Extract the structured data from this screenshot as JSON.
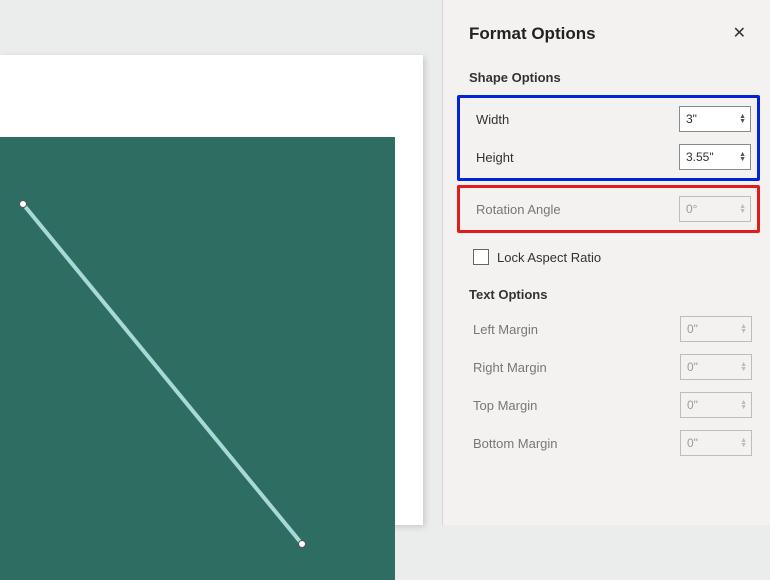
{
  "panel": {
    "title": "Format Options",
    "sections": {
      "shape_title": "Shape Options",
      "text_title": "Text Options"
    },
    "width": {
      "label": "Width",
      "value": "3\""
    },
    "height": {
      "label": "Height",
      "value": "3.55\""
    },
    "rotation": {
      "label": "Rotation Angle",
      "value": "0°"
    },
    "lock_aspect": {
      "label": "Lock Aspect Ratio"
    },
    "left_margin": {
      "label": "Left Margin",
      "value": "0\""
    },
    "right_margin": {
      "label": "Right Margin",
      "value": "0\""
    },
    "top_margin": {
      "label": "Top Margin",
      "value": "0\""
    },
    "bottom_margin": {
      "label": "Bottom Margin",
      "value": "0\""
    }
  },
  "shape": {
    "fill": "#2e6e62",
    "line_color": "#a8d9d9"
  }
}
